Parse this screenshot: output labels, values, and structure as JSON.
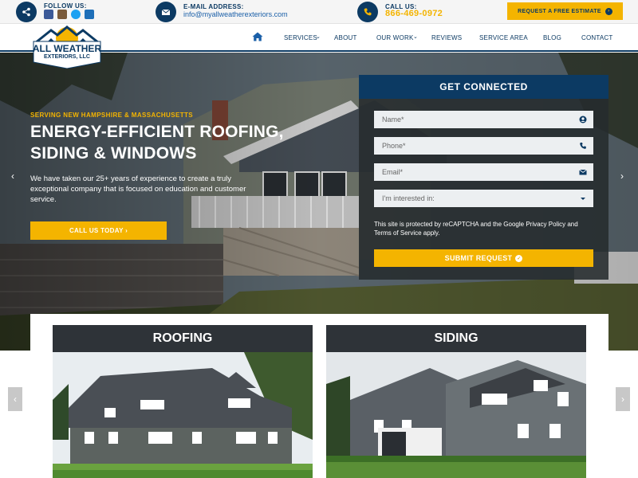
{
  "topbar": {
    "follow_label": "FOLLOW US:",
    "social_icons": [
      "facebook-icon",
      "houzz-icon",
      "twitter-icon",
      "yelp-icon"
    ],
    "email_label": "E-MAIL ADDRESS:",
    "email_value": "info@myallweatherexteriors.com",
    "call_label": "CALL US:",
    "phone_value": "866-469-0972",
    "estimate_button": "REQUEST A FREE ESTIMATE"
  },
  "logo": {
    "line1": "ALL WEATHER",
    "line2": "EXTERIORS, LLC"
  },
  "nav": {
    "items": [
      {
        "label": "SERVICES",
        "has_dropdown": true
      },
      {
        "label": "ABOUT",
        "has_dropdown": false
      },
      {
        "label": "OUR WORK",
        "has_dropdown": true
      },
      {
        "label": "REVIEWS",
        "has_dropdown": false
      },
      {
        "label": "SERVICE AREA",
        "has_dropdown": false
      },
      {
        "label": "BLOG",
        "has_dropdown": false
      },
      {
        "label": "CONTACT",
        "has_dropdown": false
      }
    ]
  },
  "hero": {
    "serving": "SERVING NEW HAMPSHIRE & MASSACHUSETTS",
    "headline": "ENERGY-EFFICIENT ROOFING, SIDING & WINDOWS",
    "description": "We have taken our 25+ years of experience to create a truly exceptional company that is focused on education and customer service.",
    "cta": "CALL US TODAY ›"
  },
  "form": {
    "title": "GET CONNECTED",
    "name_placeholder": "Name*",
    "phone_placeholder": "Phone*",
    "email_placeholder": "Email*",
    "interest_placeholder": "I'm interested in:",
    "recaptcha_text": "This site is protected by reCAPTCHA and the Google Privacy Policy and Terms of Service apply.",
    "submit_label": "SUBMIT REQUEST"
  },
  "services": {
    "cards": [
      {
        "title": "ROOFING"
      },
      {
        "title": "SIDING"
      }
    ]
  },
  "colors": {
    "brand_navy": "#0c3a63",
    "accent_yellow": "#f4b400",
    "link_blue": "#1a5fa8"
  }
}
